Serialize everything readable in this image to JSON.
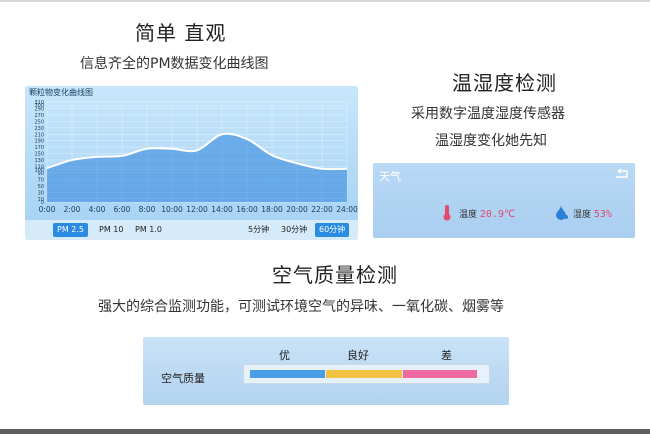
{
  "section1": {
    "title": "简单  直观",
    "subtitle": "信息齐全的PM数据变化曲线图"
  },
  "section2": {
    "title": "温湿度检测",
    "line1": "采用数字温度湿度传感器",
    "line2": "温湿度变化她先知"
  },
  "section3": {
    "title": "空气质量检测",
    "subtitle": "强大的综合监测功能，可测试环境空气的异味、一氧化碳、烟雾等"
  },
  "chart_data": {
    "type": "area",
    "title": "颗粒物变化曲线图",
    "x": [
      "0:00",
      "2:00",
      "4:00",
      "6:00",
      "8:00",
      "10:00",
      "12:00",
      "14:00",
      "16:00",
      "18:00",
      "20:00",
      "22:00",
      "24:00"
    ],
    "y_ticks": [
      0,
      10,
      30,
      50,
      70,
      90,
      100,
      110,
      130,
      150,
      170,
      190,
      210,
      230,
      250,
      270,
      290,
      300,
      310
    ],
    "y_tick_labels": [
      "0",
      "10",
      "30",
      "50",
      "70",
      "90",
      "100",
      "110",
      "130",
      "150",
      "170",
      "190",
      "210",
      "230",
      "250",
      "270",
      "290",
      "300",
      "310"
    ],
    "y_tick_labels_shown": [
      "310",
      "290",
      "270",
      "250",
      "230",
      "210",
      "190",
      "170",
      "150",
      "130",
      "110",
      "100",
      "90",
      "70",
      "50",
      "30",
      "10",
      "0"
    ],
    "axis_labels_shown": [
      "310",
      "290",
      "270",
      "250",
      "230",
      "210",
      "190",
      "170",
      "150",
      "130",
      "110",
      "100",
      "90",
      "70",
      "50",
      "30",
      "10",
      "0"
    ],
    "y_axis_labels": [
      "310",
      "290",
      "270",
      "250",
      "230",
      "210",
      "190",
      "170",
      "150",
      "130",
      "110",
      "100",
      "90",
      "70",
      "50",
      "30",
      "10",
      "0"
    ],
    "yticks_display": [
      "310",
      "290",
      "270",
      "250",
      "230",
      "210",
      "190",
      "170",
      "150",
      "130",
      "110",
      "100",
      "90",
      "70",
      "50",
      "30",
      "10",
      "0"
    ],
    "yaxis": [
      "310",
      "290",
      "270",
      "250",
      "230",
      "210",
      "190",
      "170",
      "150",
      "130",
      "110",
      "100",
      "90",
      "70",
      "50",
      "30",
      "10",
      "0"
    ],
    "yticks": [
      "310",
      "290",
      "270",
      "250",
      "230",
      "210",
      "190",
      "170",
      "150",
      "130",
      "110",
      "100",
      "90",
      "70",
      "50",
      "30",
      "10",
      "0"
    ],
    "y_labels": [
      "310",
      "290",
      "270",
      "250",
      "230",
      "210",
      "190",
      "170",
      "150",
      "130",
      "110",
      "100",
      "90",
      "70",
      "50",
      "30",
      "10",
      "0"
    ],
    "ylim": [
      0,
      310
    ],
    "values": [
      105,
      130,
      140,
      143,
      165,
      165,
      160,
      210,
      195,
      145,
      120,
      103,
      103
    ],
    "grid": true
  },
  "chart_toolbar": {
    "pm25": "PM 2.5",
    "pm10": "PM 10",
    "pm1": "PM 1.0",
    "r5": "5分钟",
    "r30": "30分钟",
    "r60": "60分钟"
  },
  "sensor": {
    "title": "天气",
    "temp_label": "温度",
    "temp_value": "20.9℃",
    "hum_label": "湿度",
    "hum_value": "53%"
  },
  "air_quality": {
    "label": "空气质量",
    "levels": [
      {
        "name": "优",
        "color": "#4a9ee8"
      },
      {
        "name": "良好",
        "color": "#f4c242"
      },
      {
        "name": "差",
        "color": "#ef6aa0"
      }
    ]
  }
}
